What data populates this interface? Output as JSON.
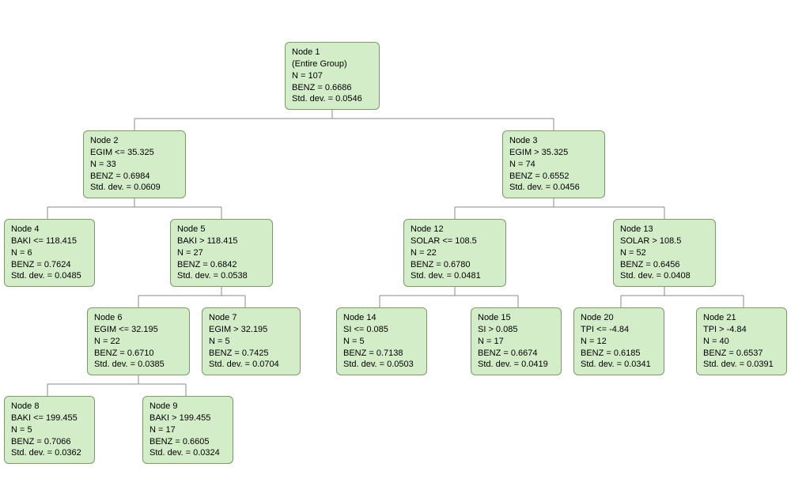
{
  "nodes": {
    "n1": {
      "title": "Node 1",
      "sub": "(Entire Group)",
      "n": "N = 107",
      "benz": "BENZ = 0.6686",
      "sd": "Std. dev. = 0.0546"
    },
    "n2": {
      "title": "Node 2",
      "cond": "EGIM <= 35.325",
      "n": "N = 33",
      "benz": "BENZ = 0.6984",
      "sd": "Std. dev. = 0.0609"
    },
    "n3": {
      "title": "Node 3",
      "cond": "EGIM > 35.325",
      "n": "N = 74",
      "benz": "BENZ = 0.6552",
      "sd": "Std. dev. = 0.0456"
    },
    "n4": {
      "title": "Node 4",
      "cond": "BAKI <= 118.415",
      "n": "N = 6",
      "benz": "BENZ = 0.7624",
      "sd": "Std. dev. = 0.0485"
    },
    "n5": {
      "title": "Node 5",
      "cond": "BAKI > 118.415",
      "n": "N = 27",
      "benz": "BENZ = 0.6842",
      "sd": "Std. dev. = 0.0538"
    },
    "n12": {
      "title": "Node 12",
      "cond": "SOLAR <= 108.5",
      "n": "N = 22",
      "benz": "BENZ = 0.6780",
      "sd": "Std. dev. = 0.0481"
    },
    "n13": {
      "title": "Node 13",
      "cond": "SOLAR > 108.5",
      "n": "N = 52",
      "benz": "BENZ = 0.6456",
      "sd": "Std. dev. = 0.0408"
    },
    "n6": {
      "title": "Node 6",
      "cond": "EGIM <= 32.195",
      "n": "N = 22",
      "benz": "BENZ = 0.6710",
      "sd": "Std. dev. = 0.0385"
    },
    "n7": {
      "title": "Node 7",
      "cond": "EGIM > 32.195",
      "n": "N = 5",
      "benz": "BENZ = 0.7425",
      "sd": "Std. dev. = 0.0704"
    },
    "n14": {
      "title": "Node 14",
      "cond": "SI <= 0.085",
      "n": "N = 5",
      "benz": "BENZ = 0.7138",
      "sd": "Std. dev. = 0.0503"
    },
    "n15": {
      "title": "Node 15",
      "cond": "SI > 0.085",
      "n": "N = 17",
      "benz": "BENZ = 0.6674",
      "sd": "Std. dev. = 0.0419"
    },
    "n20": {
      "title": "Node 20",
      "cond": "TPI <= -4.84",
      "n": "N = 12",
      "benz": "BENZ = 0.6185",
      "sd": "Std. dev. = 0.0341"
    },
    "n21": {
      "title": "Node 21",
      "cond": "TPI > -4.84",
      "n": "N = 40",
      "benz": "BENZ = 0.6537",
      "sd": "Std. dev. = 0.0391"
    },
    "n8": {
      "title": "Node 8",
      "cond": "BAKI <= 199.455",
      "n": "N = 5",
      "benz": "BENZ = 0.7066",
      "sd": "Std. dev. = 0.0362"
    },
    "n9": {
      "title": "Node 9",
      "cond": "BAKI > 199.455",
      "n": "N = 17",
      "benz": "BENZ = 0.6605",
      "sd": "Std. dev. = 0.0324"
    }
  }
}
